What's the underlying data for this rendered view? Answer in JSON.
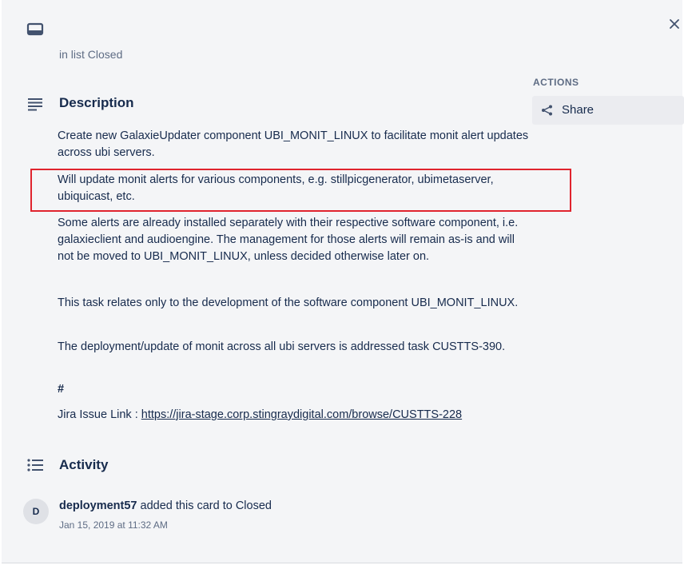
{
  "card": {
    "list_prefix": "in list",
    "list_name": "Closed"
  },
  "icons": {
    "card": "card-icon",
    "close": "close-icon",
    "description": "description-icon",
    "activity": "activity-icon",
    "share": "share-icon"
  },
  "actions": {
    "heading": "ACTIONS",
    "share_label": "Share"
  },
  "description": {
    "title": "Description",
    "paragraphs": [
      "Create new GalaxieUpdater component UBI_MONIT_LINUX to facilitate monit alert updates across ubi servers.",
      "Will update monit alerts for various components, e.g. stillpicgenerator, ubimetaserver, ubiquicast, etc.",
      "Some alerts are already installed separately with their respective software component, i.e. galaxieclient and audioengine. The management for those alerts will remain as-is and will not be moved to UBI_MONIT_LINUX, unless decided otherwise later on.",
      "This task relates only to the development of the software component UBI_MONIT_LINUX.",
      "The deployment/update of monit across all ubi servers is addressed task CUSTTS-390.",
      "#"
    ],
    "jira_label": "Jira Issue Link :",
    "jira_url": "https://jira-stage.corp.stingraydigital.com/browse/CUSTTS-228"
  },
  "activity": {
    "title": "Activity",
    "entries": [
      {
        "avatar_initial": "D",
        "user": "deployment57",
        "action": "added this card to Closed",
        "timestamp": "Jan 15, 2019 at 11:32 AM"
      }
    ]
  },
  "colors": {
    "background": "#f4f5f7",
    "text": "#172b4d",
    "muted_text": "#5e6c84",
    "button_bg": "#ebecf0",
    "highlight_border": "#e0242e"
  }
}
